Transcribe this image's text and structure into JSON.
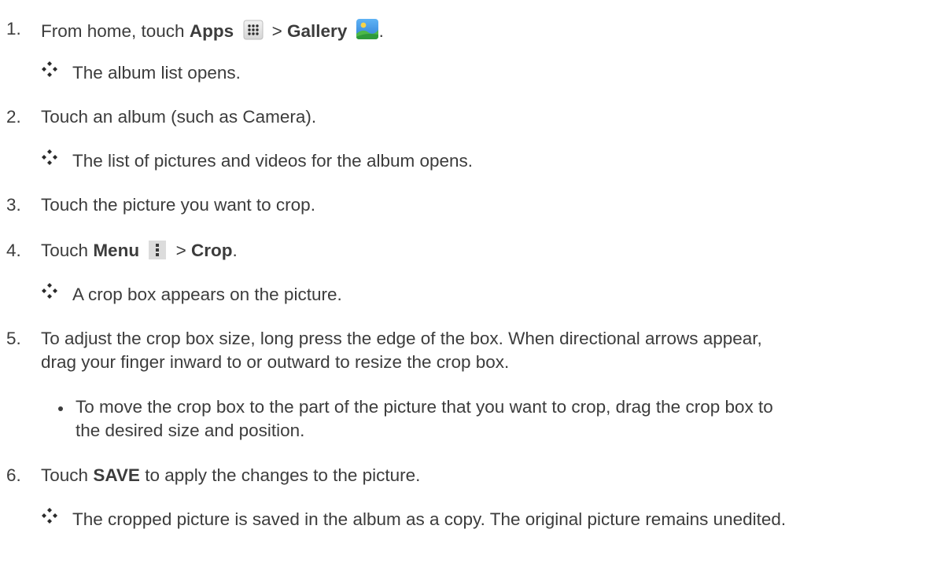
{
  "steps": [
    {
      "num": "1.",
      "prefix": "From home, touch",
      "apps": "Apps",
      "sep": ">",
      "gallery": "Gallery",
      "suffix": "."
    },
    {
      "num": "2.",
      "text": "Touch an album (such as Camera)."
    },
    {
      "num": "3.",
      "text": "Touch the picture you want to crop."
    },
    {
      "num": "4.",
      "prefix": "Touch",
      "menu": "Menu",
      "sep": ">",
      "crop": "Crop",
      "suffix": "."
    },
    {
      "num": "5.",
      "line1": "To adjust the crop box size, long press the edge of the box. When directional arrows appear,",
      "line2": "drag your finger inward to or outward to resize the crop box."
    },
    {
      "num": "6.",
      "prefix": "Touch",
      "save": "SAVE",
      "suffix": "to apply the changes to the picture."
    }
  ],
  "results": {
    "r1": "The album list opens.",
    "r2": "The list of pictures and videos for the album opens.",
    "r4": "A crop box appears on the picture.",
    "r6": "The cropped picture is saved in the album as a copy. The original picture remains unedited."
  },
  "bullet": {
    "line1": "To move the crop box to the part of the picture that you want to crop, drag the crop box to",
    "line2": "the desired size and position."
  },
  "icons": {
    "apps": "apps-grid-icon",
    "gallery": "gallery-icon",
    "menu": "menu-dots-icon",
    "result": "result-diamond-icon"
  }
}
